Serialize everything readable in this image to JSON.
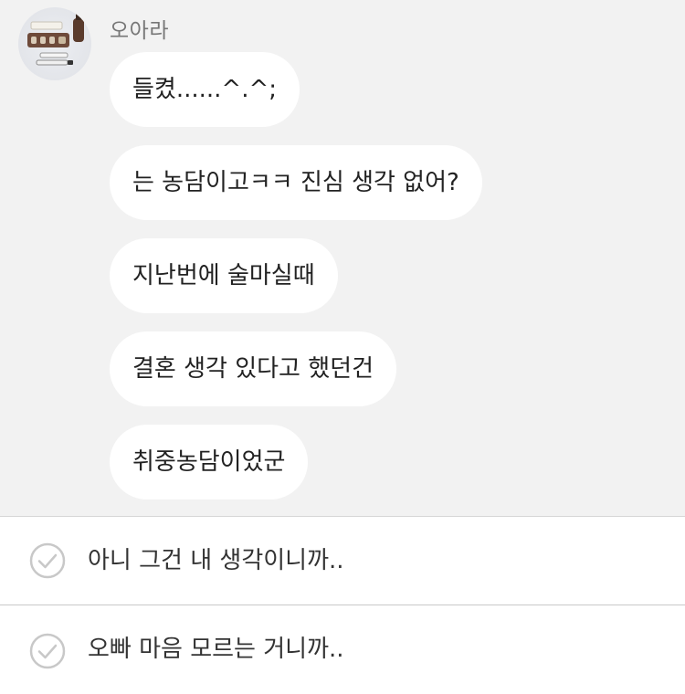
{
  "chat": {
    "sender_name": "오아라",
    "avatar_icon": "product-photo-avatar",
    "messages": [
      {
        "text": "들켰......^.^;"
      },
      {
        "text": "는 농담이고ㅋㅋ 진심 생각 없어?"
      },
      {
        "text": "지난번에 술마실때"
      },
      {
        "text": "결혼 생각 있다고 했던건"
      },
      {
        "text": "취중농담이었군"
      }
    ]
  },
  "choices": [
    {
      "label": "아니 그건 내 생각이니까..",
      "icon": "check-circle-icon"
    },
    {
      "label": "오빠 마음 모르는 거니까..",
      "icon": "check-circle-icon"
    }
  ],
  "colors": {
    "chat_background": "#f2f2f2",
    "bubble": "#ffffff",
    "check_icon": "#c8c8c8"
  }
}
